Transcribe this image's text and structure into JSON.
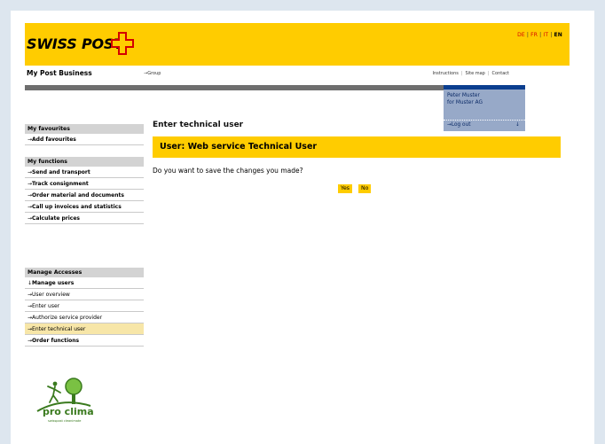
{
  "header": {
    "logo_text": "SWISS POST",
    "brand_color": "#ffcc00",
    "cross_color": "#d40000",
    "languages": [
      {
        "code": "DE",
        "active": false
      },
      {
        "code": "FR",
        "active": false
      },
      {
        "code": "IT",
        "active": false
      },
      {
        "code": "EN",
        "active": true
      }
    ]
  },
  "subbar": {
    "title": "My Post Business",
    "group_link": "Group",
    "links": [
      "Instructions",
      "Site map",
      "Contact"
    ]
  },
  "user": {
    "name": "Peter Muster",
    "company": "for Muster AG",
    "logout": "Log out"
  },
  "sidebar": {
    "favourites": {
      "heading": "My favourites",
      "items": [
        "Add favourites"
      ]
    },
    "functions": {
      "heading": "My functions",
      "items": [
        "Send and transport",
        "Track consignment",
        "Order material and documents",
        "Call up invoices and statistics",
        "Calculate prices"
      ]
    },
    "accesses": {
      "heading": "Manage Accesses",
      "manage_users": "Manage users",
      "sub_items": [
        "User overview",
        "Enter user",
        "Authorize service provider",
        "Enter technical user"
      ],
      "order_functions": "Order functions"
    }
  },
  "main": {
    "page_title": "Enter technical user",
    "banner_title": "User: Web service Technical User",
    "question": "Do you want to save the changes you made?",
    "yes_label": "Yes",
    "no_label": "No"
  },
  "footer": {
    "logo_text": "pro clima",
    "logo_subtext": "swisspost cleanimate"
  }
}
